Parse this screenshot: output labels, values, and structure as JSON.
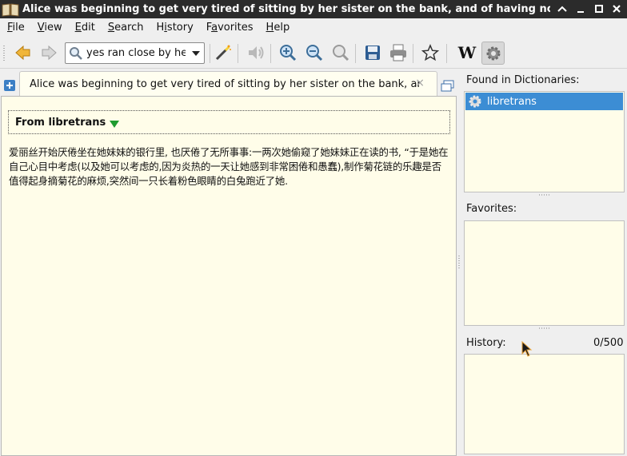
{
  "window": {
    "title": "Alice was beginning to get very tired of sitting by her sister on the bank, and of having nothing to do: once or"
  },
  "menu": [
    "File",
    "View",
    "Edit",
    "Search",
    "History",
    "Favorites",
    "Help"
  ],
  "menu_mnemonics": [
    "F",
    "V",
    "E",
    "S",
    "i",
    "a",
    "H"
  ],
  "toolbar": {
    "search_value": "yes ran close by her.",
    "icons": [
      "back-arrow-icon",
      "forward-arrow-icon",
      "search-icon",
      "dropdown-arrow-icon",
      "scan-wand-icon",
      "speaker-icon",
      "zoom-in-icon",
      "zoom-out-icon",
      "zoom-reset-icon",
      "save-icon",
      "print-icon",
      "favorite-star-icon",
      "wikipedia-icon",
      "settings-gear-icon"
    ]
  },
  "tab": {
    "label": "Alice was beginning to get very tired of sitting by her sister on the bank, and...",
    "close": "×"
  },
  "article": {
    "dict_header": "From libretrans",
    "translation": "爱丽丝开始厌倦坐在她妹妹的银行里, 也厌倦了无所事事:一两次她偷窥了她妹妹正在读的书, “于是她在自己心目中考虑(以及她可以考虑的,因为炎热的一天让她感到非常困倦和愚蠢),制作菊花链的乐趣是否值得起身摘菊花的麻烦,突然间一只长着粉色眼睛的白兔跑近了她."
  },
  "side": {
    "found_label": "Found in Dictionaries:",
    "dictionaries": [
      "libretrans"
    ],
    "favorites_label": "Favorites:",
    "history_label": "History:",
    "history_count": "0/500"
  },
  "colors": {
    "accent": "#3c8dd4",
    "article_bg": "#fffde9",
    "titlebar": "#2b2b2b"
  }
}
